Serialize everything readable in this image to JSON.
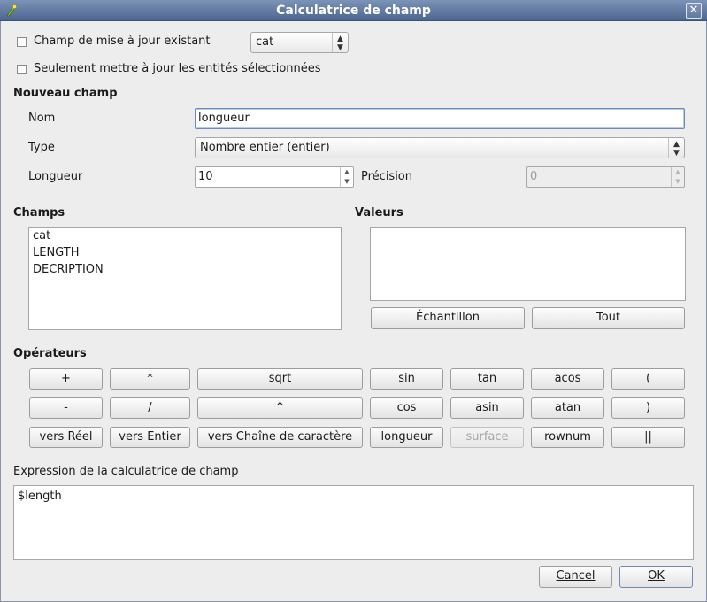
{
  "window": {
    "title": "Calculatrice de champ",
    "close_glyph": "✕",
    "app_icon": "qgis-icon"
  },
  "update_existing": {
    "label": "Champ de mise à jour existant",
    "checked": false,
    "selected_field": "cat"
  },
  "selected_only": {
    "label": "Seulement mettre à jour les entités sélectionnées",
    "checked": false
  },
  "new_field": {
    "heading": "Nouveau champ",
    "name_label": "Nom",
    "name_value": "longueur",
    "type_label": "Type",
    "type_value": "Nombre entier (entier)",
    "length_label": "Longueur",
    "length_value": "10",
    "precision_label": "Précision",
    "precision_value": "0"
  },
  "fields": {
    "heading": "Champs",
    "items": [
      "cat",
      "LENGTH",
      "DECRIPTION"
    ]
  },
  "values": {
    "heading": "Valeurs",
    "sample_button": "Échantillon",
    "all_button": "Tout"
  },
  "operators": {
    "heading": "Opérateurs",
    "plus": "+",
    "multiply": "*",
    "sqrt": "sqrt",
    "sin": "sin",
    "tan": "tan",
    "acos": "acos",
    "open_paren": "(",
    "minus": "-",
    "divide": "/",
    "power": "^",
    "cos": "cos",
    "asin": "asin",
    "atan": "atan",
    "close_paren": ")",
    "to_real": "vers Réel",
    "to_int": "vers Entier",
    "to_string": "vers Chaîne de caractère",
    "length": "longueur",
    "area": "surface",
    "rownum": "rownum",
    "concat": "||"
  },
  "expression": {
    "label": "Expression de la calculatrice de champ",
    "value": "$length"
  },
  "footer": {
    "cancel_label": "Cancel",
    "ok_label": "OK"
  },
  "colors": {
    "titlebar": "#5a73a0",
    "background": "#ededed",
    "focus": "#6a8ab8"
  }
}
